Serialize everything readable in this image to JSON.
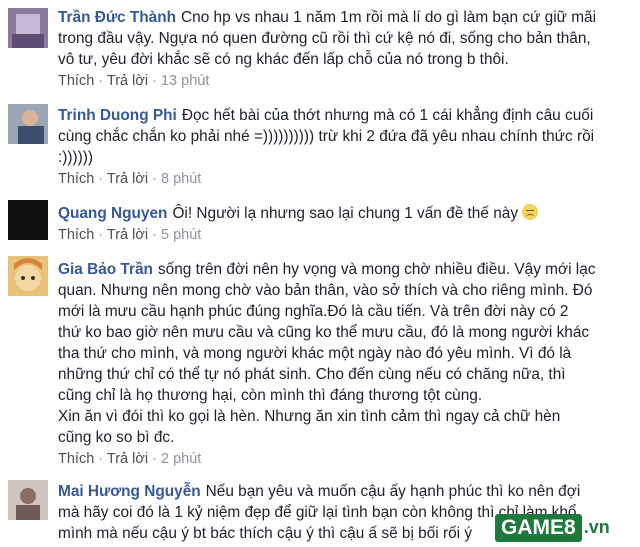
{
  "comments": [
    {
      "name": "Trần Đức Thành",
      "lines": [
        "Cno hp vs nhau 1 năm 1m rồi mà lí do gì làm bạn cứ giữ mãi",
        "trong đầu vậy. Ngựa nó quen đường cũ rồi thì cứ kệ nó đi, sống cho bản thân,",
        "vô tư, yêu đời khắc sẽ có ng khác đến lấp chỗ của nó trong b thôi."
      ],
      "like": "Thích",
      "reply": "Trả lời",
      "time": "13 phút"
    },
    {
      "name": "Trinh Duong Phi",
      "lines": [
        "Đọc hết bài của thớt nhưng mà có 1 cái khẳng định câu cuối",
        "cùng chắc chắn ko phải nhé =)))))))))) trừ khi 2 đứa đã yêu nhau chính thức rồi",
        ":))))))"
      ],
      "like": "Thích",
      "reply": "Trả lời",
      "time": "8 phút"
    },
    {
      "name": "Quang Nguyen",
      "lines": [
        "Ôi! Người lạ nhưng sao lại chung 1 vấn đề thế này"
      ],
      "emoji": "disappointed-face",
      "like": "Thích",
      "reply": "Trả lời",
      "time": "5 phút"
    },
    {
      "name": "Gia Bảo Trần",
      "lines": [
        "sống trên đời nên hy vọng và mong chờ nhiều điều. Vậy mới lạc",
        "quan. Nhưng nên mong chờ vào bản thân, vào sở thích và cho riêng mình. Đó",
        "mới là mưu cầu hạnh phúc đúng nghĩa.Đó là cầu tiến. Và trên đời này có 2",
        "thứ ko bao giờ nên mưu cầu và cũng ko thể mưu cầu, đó là mong người khác",
        "tha thứ cho mình, và mong người khác một ngày nào đó yêu mình. Vì đó là",
        "những thứ chỉ có thể tự nó phát sinh. Cho đến cùng nếu có chăng nữa, thì",
        "cũng chỉ là họ thương hại, còn mình thì đáng thương tột cùng.",
        "Xin ăn vì đói thì ko gọi là hèn. Nhưng ăn xin tình cảm thì ngay cả chữ hèn",
        "cũng ko so bì đc."
      ],
      "like": "Thích",
      "reply": "Trả lời",
      "time": "2 phút"
    },
    {
      "name": "Mai Hương Nguyễn",
      "lines": [
        "Nếu bạn yêu và muốn cậu ấy hạnh phúc thì ko nên đợi",
        "mà hãy coi đó là 1 kỷ niệm đẹp để giữ lại tình bạn còn không thì chỉ làm khổ",
        "mình mà nếu cậu ý bt bác thích cậu ý thì cậu ấ sẽ bị bối rối ý"
      ]
    }
  ],
  "watermark": {
    "box": "GAME8",
    "suffix": ".vn"
  },
  "colors": {
    "name": "#365899",
    "text": "#1d2129",
    "meta": "#90949c",
    "watermark": "#1d7a3c"
  }
}
